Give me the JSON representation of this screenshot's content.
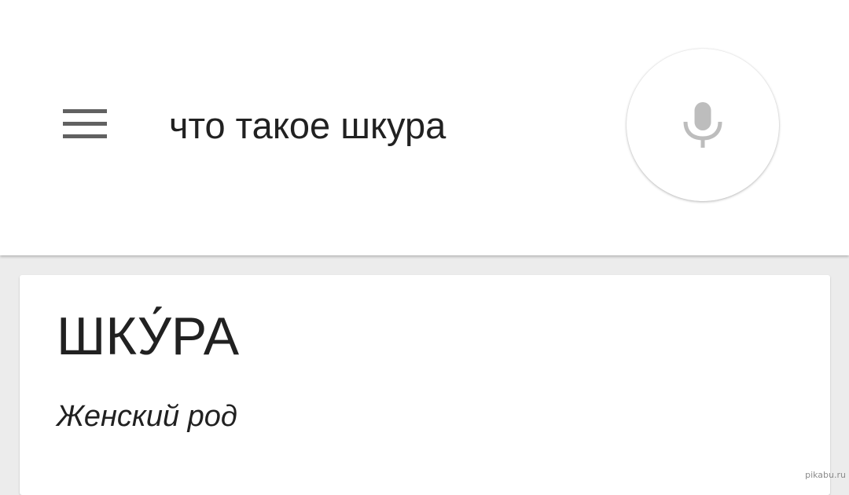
{
  "header": {
    "menu_icon": "hamburger-menu-icon",
    "query": "что такое шкура",
    "mic_icon": "microphone-icon",
    "mic_color": "#bdbdbd"
  },
  "result_card": {
    "word": "ШКУ́РА",
    "gender": "Женский род"
  },
  "watermark": "pikabu.ru"
}
